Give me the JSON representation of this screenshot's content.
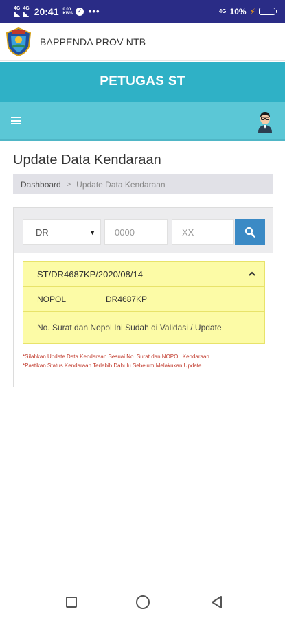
{
  "status_bar": {
    "signal1": "4G",
    "signal2": "4G",
    "time": "20:41",
    "speed_value": "0.00",
    "speed_unit": "KB/S",
    "dots": "•••",
    "network": "4G",
    "battery": "10%"
  },
  "header": {
    "app_name": "BAPPENDA PROV NTB",
    "logo_icon": "ntb-crest-logo"
  },
  "title_band": {
    "text": "PETUGAS ST"
  },
  "nav": {
    "menu_icon": "hamburger-icon",
    "avatar_icon": "officer-avatar-icon"
  },
  "page": {
    "title": "Update Data Kendaraan",
    "breadcrumb": {
      "home": "Dashboard",
      "separator": ">",
      "current": "Update Data Kendaraan"
    }
  },
  "search": {
    "prefix_selected": "DR",
    "number_placeholder": "0000",
    "suffix_placeholder": "XX",
    "button_icon": "search-icon"
  },
  "result": {
    "header": "ST/DR4687KP/2020/08/14",
    "nopol_label": "NOPOL",
    "nopol_value": "DR4687KP",
    "message": "No. Surat dan Nopol Ini Sudah di Validasi / Update"
  },
  "notes": [
    "*Silahkan Update Data Kendaraan Sesuai No. Surat dan NOPOL Kendaraan",
    "*Pastikan Status Kendaraan Terlebih Dahulu Sebelum Melakukan Update"
  ],
  "colors": {
    "status_bar": "#2a2c86",
    "title_band": "#2fb1c6",
    "nav_bar": "#5bc7d6",
    "search_button": "#3b8ac5",
    "result_bg": "#fcfba6",
    "note_text": "#c0392b"
  }
}
